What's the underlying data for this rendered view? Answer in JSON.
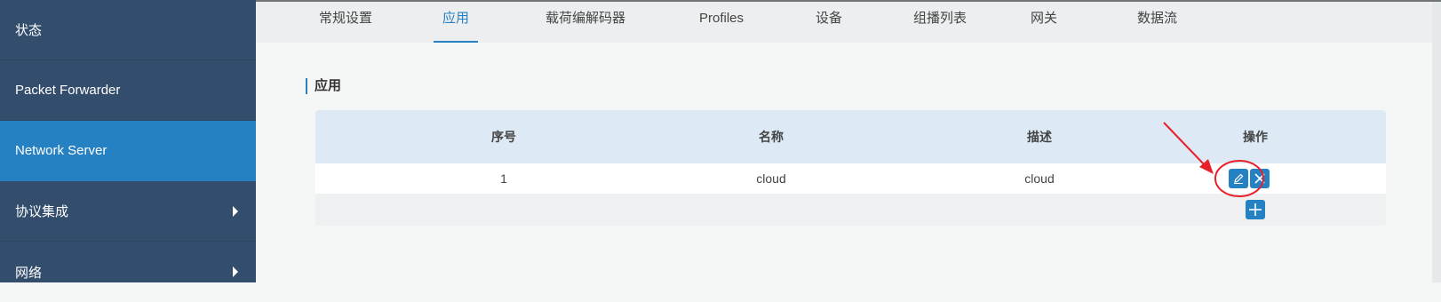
{
  "sidebar": {
    "items": [
      {
        "label": "状态"
      },
      {
        "label": "Packet Forwarder"
      },
      {
        "label": "Network Server"
      },
      {
        "label": "协议集成"
      },
      {
        "label": "网络"
      }
    ]
  },
  "tabs": [
    {
      "label": "常规设置"
    },
    {
      "label": "应用"
    },
    {
      "label": "载荷编解码器"
    },
    {
      "label": "Profiles"
    },
    {
      "label": "设备"
    },
    {
      "label": "组播列表"
    },
    {
      "label": "网关"
    },
    {
      "label": "数据流"
    }
  ],
  "section": {
    "title": "应用"
  },
  "table": {
    "headers": [
      "序号",
      "名称",
      "描述",
      "操作"
    ],
    "rows": [
      {
        "index": "1",
        "name": "cloud",
        "description": "cloud"
      }
    ]
  },
  "colors": {
    "sidebar_bg": "#334d6c",
    "sidebar_active": "#2681c3",
    "accent": "#2681c3",
    "annotation": "#e8202a"
  },
  "icons": {
    "edit": "pencil-icon",
    "delete": "close-icon",
    "add": "plus-icon"
  }
}
